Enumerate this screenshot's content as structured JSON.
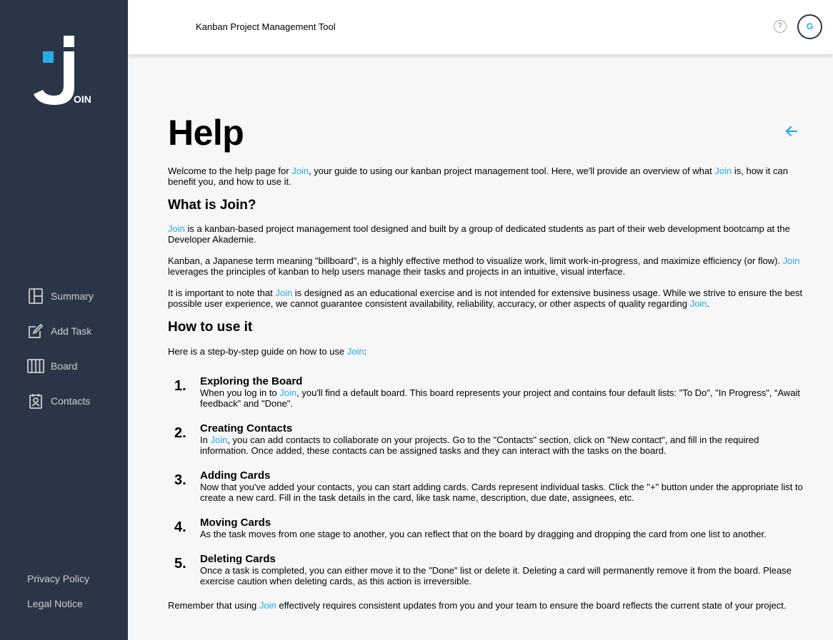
{
  "app": {
    "header_title": "Kanban Project Management Tool",
    "avatar_initial": "G",
    "help_icon": "?",
    "accent": "#29abe2",
    "sidebar_bg": "#2a3647",
    "logo_text": "OIN"
  },
  "sidebar": {
    "items": [
      {
        "label": "Summary",
        "icon": "summary-icon"
      },
      {
        "label": "Add Task",
        "icon": "add-task-icon"
      },
      {
        "label": "Board",
        "icon": "board-icon"
      },
      {
        "label": "Contacts",
        "icon": "contacts-icon"
      }
    ],
    "footer": [
      {
        "label": "Privacy Policy"
      },
      {
        "label": "Legal Notice"
      }
    ]
  },
  "page": {
    "title": "Help",
    "brand": "Join",
    "intro": {
      "a": "Welcome to the help page for ",
      "b": ", your guide to using our kanban project management tool. Here, we'll provide an overview of what ",
      "c": " is, how it can benefit you, and how to use it."
    },
    "what_heading": "What is Join?",
    "p1": " is a kanban-based project management tool designed and built by a group of dedicated students as part of their web development bootcamp at the Developer Akademie.",
    "p2": {
      "a": "Kanban, a Japanese term meaning \"billboard\", is a highly effective method to visualize work, limit work-in-progress, and maximize efficiency (or flow). ",
      "b": " leverages the principles of kanban to help users manage their tasks and projects in an intuitive, visual interface."
    },
    "p3": {
      "a": "It is important to note that ",
      "b": " is designed as an educational exercise and is not intended for extensive business usage. While we strive to ensure the best possible user experience, we cannot guarantee consistent availability, reliability, accuracy, or other aspects of quality regarding ",
      "c": "."
    },
    "how_heading": "How to use it",
    "p4": {
      "a": "Here is a step-by-step guide on how to use ",
      "b": ":"
    },
    "steps": [
      {
        "num": "1.",
        "title": "Exploring the Board",
        "a": "When you log in to ",
        "b": ", you'll find a default board. This board represents your project and contains four default lists: \"To Do\", \"In Progress\", “Await feedback” and \"Done\"."
      },
      {
        "num": "2.",
        "title": "Creating Contacts",
        "a": "In ",
        "b": ", you can add contacts to collaborate on your projects. Go to the \"Contacts\" section, click on \"New contact\", and fill in the required information. Once added, these contacts can be assigned tasks and they can interact with the tasks on the board."
      },
      {
        "num": "3.",
        "title": "Adding Cards",
        "text": "Now that you've added your contacts, you can start adding cards. Cards represent individual tasks. Click the \"+\" button under the appropriate list to create a new card. Fill in the task details in the card, like task name, description, due date, assignees, etc."
      },
      {
        "num": "4.",
        "title": "Moving Cards",
        "text": "As the task moves from one stage to another, you can reflect that on the board by dragging and dropping the card from one list to another."
      },
      {
        "num": "5.",
        "title": "Deleting Cards",
        "text": "Once a task is completed, you can either move it to the \"Done\" list or delete it. Deleting a card will permanently remove it from the board. Please exercise caution when deleting cards, as this action is irreversible."
      }
    ],
    "outro": {
      "a": "Remember that using ",
      "b": " effectively requires consistent updates from you and your team to ensure the board reflects the current state of your project."
    }
  }
}
